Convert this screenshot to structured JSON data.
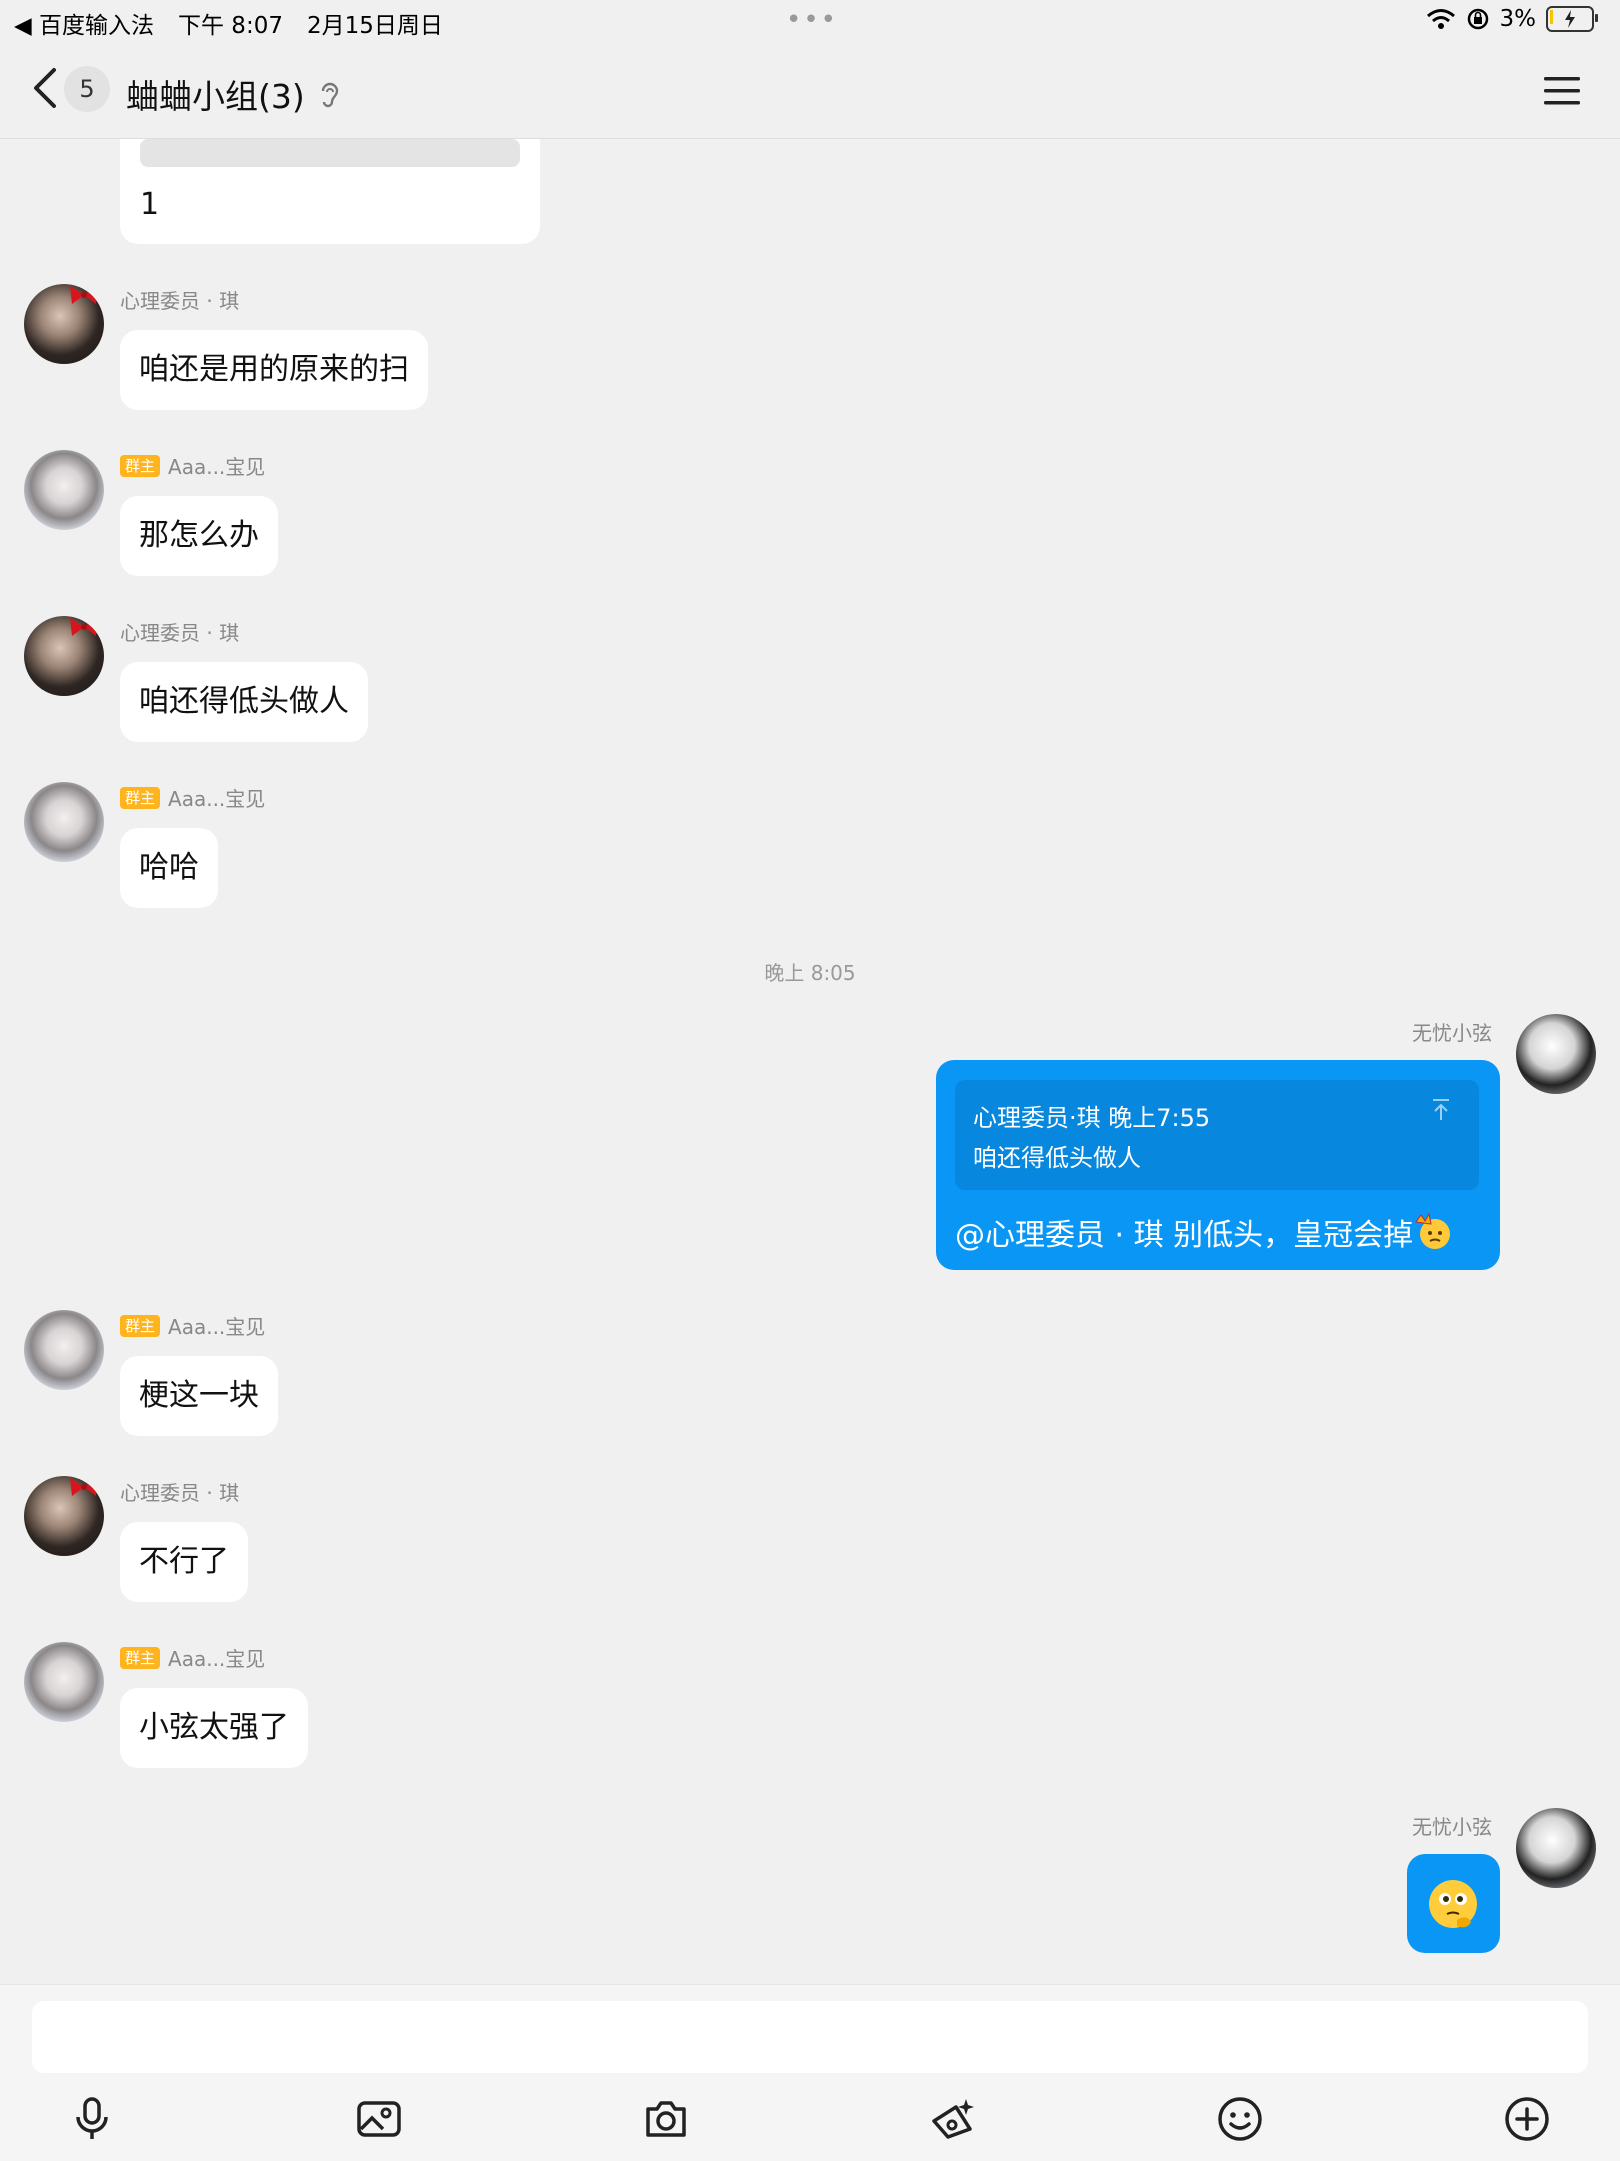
{
  "status_bar": {
    "left_app": "◀ 百度输入法",
    "time": "下午 8:07",
    "date": "2月15日周日",
    "dots": "•••",
    "battery": "3%"
  },
  "header": {
    "unread_count": "5",
    "title": "蛐蛐小组(3)"
  },
  "messages": {
    "partial": {
      "text": "1"
    },
    "m1": {
      "sender": "心理委员 · 琪",
      "text": "咱还是用的原来的扫"
    },
    "m2": {
      "tag": "群主",
      "sender": "Aaa...宝见",
      "text": "那怎么办"
    },
    "m3": {
      "sender": "心理委员 · 琪",
      "text": "咱还得低头做人"
    },
    "m4": {
      "tag": "群主",
      "sender": "Aaa...宝见",
      "text": "哈哈"
    },
    "time_sep": "晚上 8:05",
    "m5": {
      "sender": "无忧小弦",
      "quote_head": "心理委员·琪 晚上7:55",
      "quote_text": "咱还得低头做人",
      "text": "@心理委员 · 琪 别低头，皇冠会掉"
    },
    "m6": {
      "tag": "群主",
      "sender": "Aaa...宝见",
      "text": "梗这一块"
    },
    "m7": {
      "sender": "心理委员 · 琪",
      "text": "不行了"
    },
    "m8": {
      "tag": "群主",
      "sender": "Aaa...宝见",
      "text": "小弦太强了"
    },
    "m9": {
      "sender": "无忧小弦"
    }
  },
  "toolbar": {
    "icons": [
      "microphone-icon",
      "image-icon",
      "camera-icon",
      "red-packet-icon",
      "emoji-icon",
      "plus-icon"
    ]
  },
  "colors": {
    "self_bubble": "#0a96f5",
    "owner_tag": "#ffb41e",
    "background": "#f0f0f0"
  }
}
